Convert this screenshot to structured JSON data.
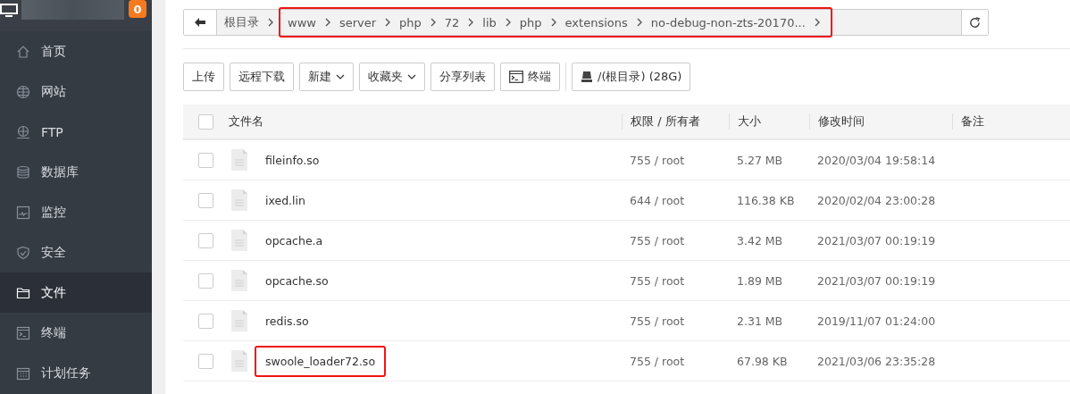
{
  "sidebar": {
    "badge": "0",
    "items": [
      {
        "label": "首页",
        "kind": "home",
        "selected": false
      },
      {
        "label": "网站",
        "kind": "globe",
        "selected": false
      },
      {
        "label": "FTP",
        "kind": "ftp",
        "selected": false
      },
      {
        "label": "数据库",
        "kind": "database",
        "selected": false
      },
      {
        "label": "监控",
        "kind": "monitor",
        "selected": false
      },
      {
        "label": "安全",
        "kind": "shield",
        "selected": false
      },
      {
        "label": "文件",
        "kind": "folder",
        "selected": true
      },
      {
        "label": "终端",
        "kind": "terminal",
        "selected": false
      },
      {
        "label": "计划任务",
        "kind": "calendar",
        "selected": false
      }
    ]
  },
  "breadcrumb": {
    "root": "根目录",
    "path": [
      "www",
      "server",
      "php",
      "72",
      "lib",
      "php",
      "extensions",
      "no-debug-non-zts-20170..."
    ],
    "path_highlighted": true
  },
  "toolbar": [
    {
      "label": "上传",
      "kind": "plain"
    },
    {
      "label": "远程下载",
      "kind": "plain"
    },
    {
      "label": "新建",
      "kind": "dropdown"
    },
    {
      "label": "收藏夹",
      "kind": "dropdown"
    },
    {
      "label": "分享列表",
      "kind": "plain"
    },
    {
      "label": "终端",
      "kind": "terminal"
    },
    {
      "label": "/(根目录) (28G)",
      "kind": "disk"
    }
  ],
  "table": {
    "select_all_checked": false,
    "columns": [
      "文件名",
      "权限 / 所有者",
      "大小",
      "修改时间",
      "备注"
    ],
    "rows": [
      {
        "name": "fileinfo.so",
        "perm": "755 / root",
        "size": "5.27 MB",
        "mtime": "2020/03/04 19:58:14",
        "checked": false,
        "highlighted": false
      },
      {
        "name": "ixed.lin",
        "perm": "644 / root",
        "size": "116.38 KB",
        "mtime": "2020/02/04 23:00:28",
        "checked": false,
        "highlighted": false
      },
      {
        "name": "opcache.a",
        "perm": "755 / root",
        "size": "3.42 MB",
        "mtime": "2021/03/07 00:19:19",
        "checked": false,
        "highlighted": false
      },
      {
        "name": "opcache.so",
        "perm": "755 / root",
        "size": "1.89 MB",
        "mtime": "2021/03/07 00:19:19",
        "checked": false,
        "highlighted": false
      },
      {
        "name": "redis.so",
        "perm": "755 / root",
        "size": "2.31 MB",
        "mtime": "2019/11/07 01:24:00",
        "checked": false,
        "highlighted": false
      },
      {
        "name": "swoole_loader72.so",
        "perm": "755 / root",
        "size": "67.98 KB",
        "mtime": "2021/03/06 23:35:28",
        "checked": false,
        "highlighted": true
      }
    ]
  }
}
